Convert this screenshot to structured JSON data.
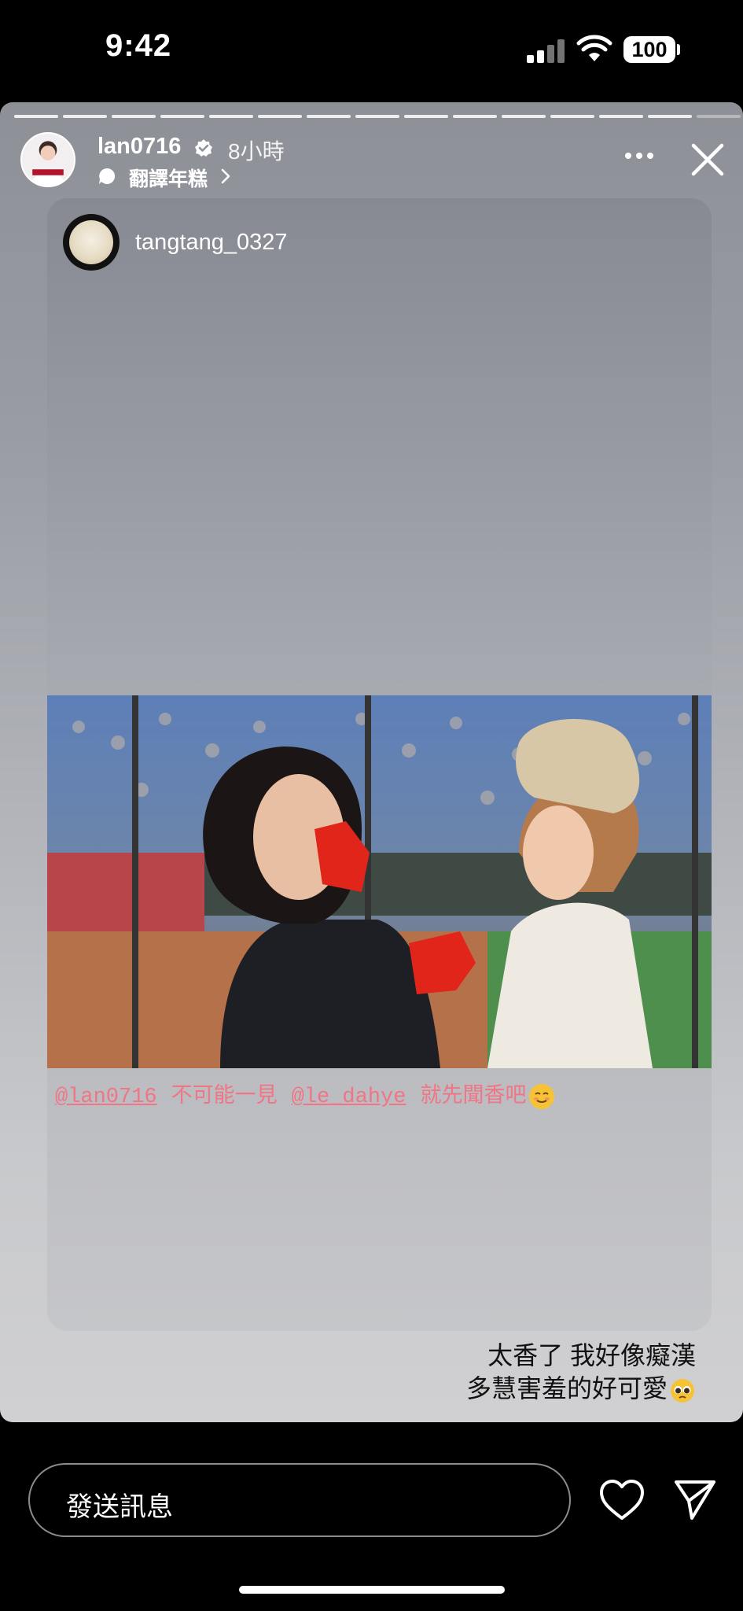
{
  "status_bar": {
    "time": "9:42",
    "battery": "100"
  },
  "story": {
    "username": "lan0716",
    "time_ago": "8小時",
    "translate_label": "翻譯年糕",
    "progress": {
      "segments": 15,
      "current": 15
    },
    "shared_post": {
      "username": "tangtang_0327",
      "caption": {
        "mention1": "@lan0716",
        "text1": "不可能一見",
        "mention2": "@le_dahye",
        "text2": "就先聞香吧"
      }
    },
    "story_text": {
      "line1": "太香了 我好像癡漢",
      "line2": "多慧害羞的好可愛"
    }
  },
  "bottom_bar": {
    "message_placeholder": "發送訊息"
  },
  "icons": [
    "signal-icon",
    "wifi-icon",
    "battery-icon",
    "verified-icon",
    "translate-icon",
    "chevron-right-icon",
    "more-icon",
    "close-icon",
    "heart-icon",
    "send-icon"
  ]
}
